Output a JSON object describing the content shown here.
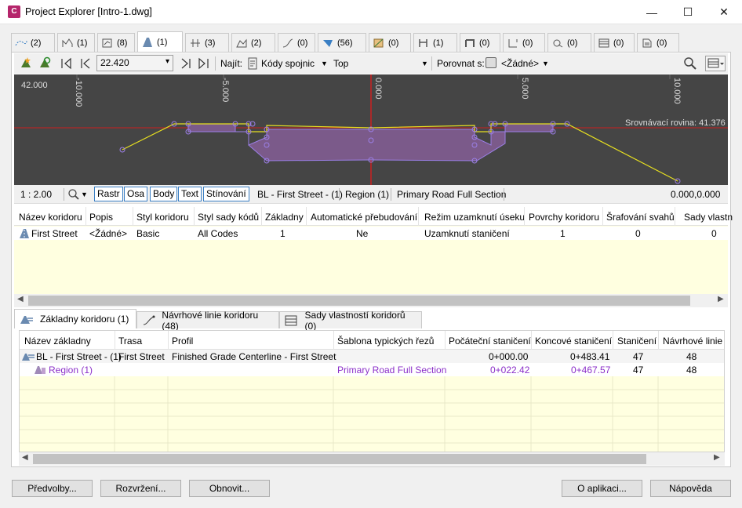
{
  "window": {
    "title": "Project Explorer [Intro-1.dwg]",
    "app_icon": "C",
    "minimize": "—",
    "maximize": "☐",
    "close": "✕"
  },
  "tabs": [
    {
      "icon": "alignment-icon",
      "count": "(2)"
    },
    {
      "icon": "profile-icon",
      "count": "(1)"
    },
    {
      "icon": "profile-view-icon",
      "count": "(8)"
    },
    {
      "icon": "corridor-icon",
      "count": "(1)"
    },
    {
      "icon": "sample-lines-icon",
      "count": "(3)"
    },
    {
      "icon": "surface-icon",
      "count": "(2)"
    },
    {
      "icon": "feature-line-icon",
      "count": "(0)"
    },
    {
      "icon": "assembly-icon",
      "count": "(56)"
    },
    {
      "icon": "parcel-icon",
      "count": "(0)"
    },
    {
      "icon": "pipe-network-icon",
      "count": "(1)"
    },
    {
      "icon": "pressure-network-icon",
      "count": "(0)"
    },
    {
      "icon": "section-view-icon",
      "count": "(0)"
    },
    {
      "icon": "intersection-icon",
      "count": "(0)"
    },
    {
      "icon": "table-icon",
      "count": "(0)"
    },
    {
      "icon": "data-shortcut-icon",
      "count": "(0)"
    }
  ],
  "toolbar": {
    "zoom_value": "22.420",
    "find_label": "Najít:",
    "find_type": "Kódy spojnic",
    "find_target": "Top",
    "compare_label": "Porovnat s:",
    "compare_value": "<Žádné>"
  },
  "viewport": {
    "y_label": "42.000",
    "x_ticks": [
      "-10.000",
      "-5.000",
      "0.000",
      "5.000",
      "10.000"
    ],
    "datum_label": "Srovnávací rovina: 41.376"
  },
  "vstatus": {
    "scale": "1 : 2.00",
    "buttons": [
      "Rastr",
      "Osa",
      "Body",
      "Text",
      "Stínování"
    ],
    "baseline": "BL - First Street - (1)",
    "region": "Region (1)",
    "assembly": "Primary Road Full Section",
    "coords": "0.000,0.000"
  },
  "corridors": {
    "headers": [
      "Název koridoru",
      "Popis",
      "Styl koridoru",
      "Styl sady kódů",
      "Základny",
      "Automatické přebudování",
      "Režim uzamknutí úseku",
      "Povrchy koridoru",
      "Šrafování svahů",
      "Sady vlastn"
    ],
    "rows": [
      [
        "First Street",
        "<Žádné>",
        "Basic",
        "All Codes",
        "1",
        "Ne",
        "Uzamknutí staničení",
        "1",
        "0",
        "0"
      ]
    ]
  },
  "bottom_tabs": [
    "Základny koridoru (1)",
    "Návrhové linie koridoru (48)",
    "Sady vlastností koridorů (0)"
  ],
  "baselines": {
    "headers": [
      "Název základny",
      "Trasa",
      "Profil",
      "Šablona typických řezů",
      "Počáteční staničení",
      "Koncové staničení",
      "Staničení",
      "Návrhové linie"
    ],
    "rows": [
      [
        "BL - First Street - (1)",
        "First Street",
        "Finished Grade Centerline - First Street",
        "",
        "0+000.00",
        "0+483.41",
        "47",
        "48"
      ],
      [
        "Region (1)",
        "",
        "",
        "Primary Road Full Section",
        "0+022.42",
        "0+467.57",
        "47",
        "48"
      ]
    ]
  },
  "buttons": {
    "preferences": "Předvolby...",
    "layout": "Rozvržení...",
    "refresh": "Obnovit...",
    "about": "O aplikaci...",
    "help": "Nápověda"
  },
  "colors": {
    "accent": "#3a7fc4",
    "region_text": "#8b2fc9",
    "viewport_bg": "#454545",
    "grid_bg": "#ffffe0"
  }
}
